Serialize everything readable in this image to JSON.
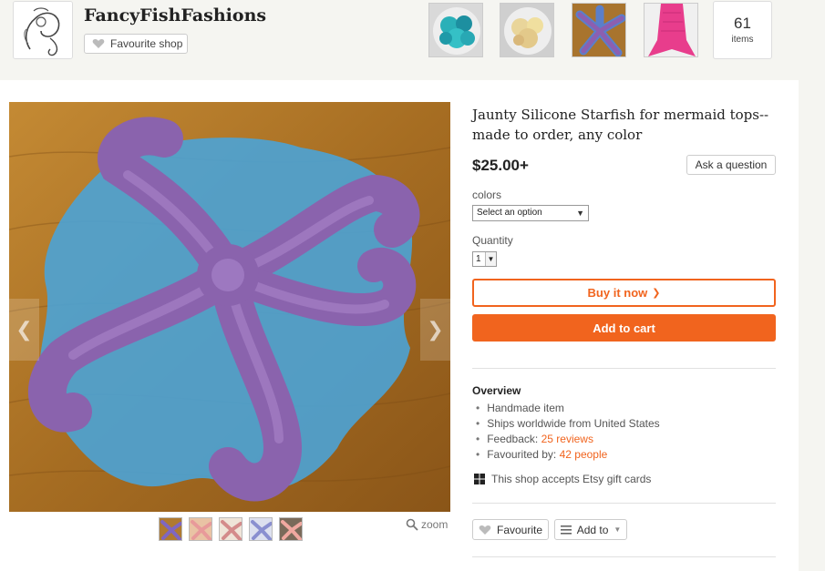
{
  "shop": {
    "name": "FancyFishFashions",
    "favourite_label": "Favourite shop",
    "items_count": "61",
    "items_label": "items"
  },
  "listing": {
    "title": "Jaunty Silicone Starfish for mermaid tops--made to order, any color",
    "price": "$25.00+",
    "ask_label": "Ask a question",
    "colors_label": "colors",
    "colors_placeholder": "Select an option",
    "quantity_label": "Quantity",
    "quantity_value": "1",
    "buy_now_label": "Buy it now",
    "add_to_cart_label": "Add to cart",
    "zoom_label": "zoom"
  },
  "overview": {
    "title": "Overview",
    "item_handmade": "Handmade item",
    "item_ships": "Ships worldwide from United States",
    "feedback_prefix": "Feedback:",
    "feedback_link": "25 reviews",
    "favourited_prefix": "Favourited by:",
    "favourited_link": "42 people",
    "gift_cards": "This shop accepts Etsy gift cards"
  },
  "actions": {
    "favourite_label": "Favourite",
    "add_to_label": "Add to"
  },
  "colors": {
    "accent": "#f1641e",
    "background": "#f5f5f1",
    "starfish_purple": "#8a63ad",
    "starfish_blue": "#4ba3d6",
    "wood": "#b87a2a"
  }
}
